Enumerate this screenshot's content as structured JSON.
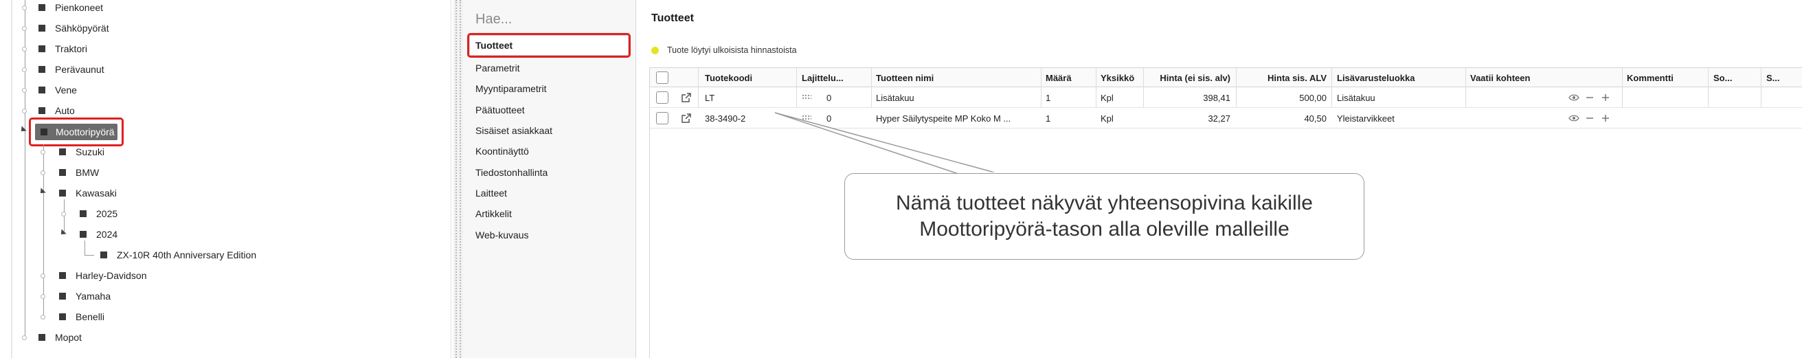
{
  "tree": {
    "items": [
      {
        "label": "Pienkoneet"
      },
      {
        "label": "Sähköpyörät"
      },
      {
        "label": "Traktori"
      },
      {
        "label": "Perävaunut"
      },
      {
        "label": "Vene"
      },
      {
        "label": "Auto"
      },
      {
        "label": "Moottoripyörä",
        "selected": true
      },
      {
        "label": "Suzuki"
      },
      {
        "label": "BMW"
      },
      {
        "label": "Kawasaki"
      },
      {
        "label": "2025"
      },
      {
        "label": "2024"
      },
      {
        "label": "ZX-10R 40th Anniversary Edition"
      },
      {
        "label": "Harley-Davidson"
      },
      {
        "label": "Yamaha"
      },
      {
        "label": "Benelli"
      },
      {
        "label": "Mopot"
      }
    ]
  },
  "nav": {
    "search_placeholder": "Hae...",
    "items": [
      {
        "label": "Tuotteet",
        "active": true
      },
      {
        "label": "Parametrit"
      },
      {
        "label": "Myyntiparametrit"
      },
      {
        "label": "Päätuotteet"
      },
      {
        "label": "Sisäiset asiakkaat"
      },
      {
        "label": "Koontinäyttö"
      },
      {
        "label": "Tiedostonhallinta"
      },
      {
        "label": "Laitteet"
      },
      {
        "label": "Artikkelit"
      },
      {
        "label": "Web-kuvaus"
      }
    ]
  },
  "main": {
    "title": "Tuotteet",
    "notice": "Tuote löytyi ulkoisista hinnastoista",
    "notice_color": "#e3e424",
    "columns": [
      "Tuotekoodi",
      "Lajittelu...",
      "Tuotteen nimi",
      "Määrä",
      "Yksikkö",
      "Hinta (ei sis. alv)",
      "Hinta sis. ALV",
      "Lisävarusteluokka",
      "Vaatii kohteen",
      "Kommentti",
      "So...",
      "S..."
    ],
    "rows": [
      {
        "code": "LT",
        "sort": "0",
        "name": "Lisätakuu",
        "qty": "1",
        "unit": "Kpl",
        "price_ex": "398,41",
        "price_inc": "500,00",
        "category": "Lisätakuu"
      },
      {
        "code": "38-3490-2",
        "sort": "0",
        "name": "Hyper Säilytyspeite MP Koko M ...",
        "qty": "1",
        "unit": "Kpl",
        "price_ex": "32,27",
        "price_inc": "40,50",
        "category": "Yleistarvikkeet"
      }
    ]
  },
  "callout": {
    "line1": "Nämä tuotteet näkyvät yhteensopivina kaikille",
    "line2": "Moottoripyörä-tason alla oleville malleille"
  },
  "colors": {
    "highlight": "#e02020",
    "selected_node": "#6b6b6b"
  }
}
